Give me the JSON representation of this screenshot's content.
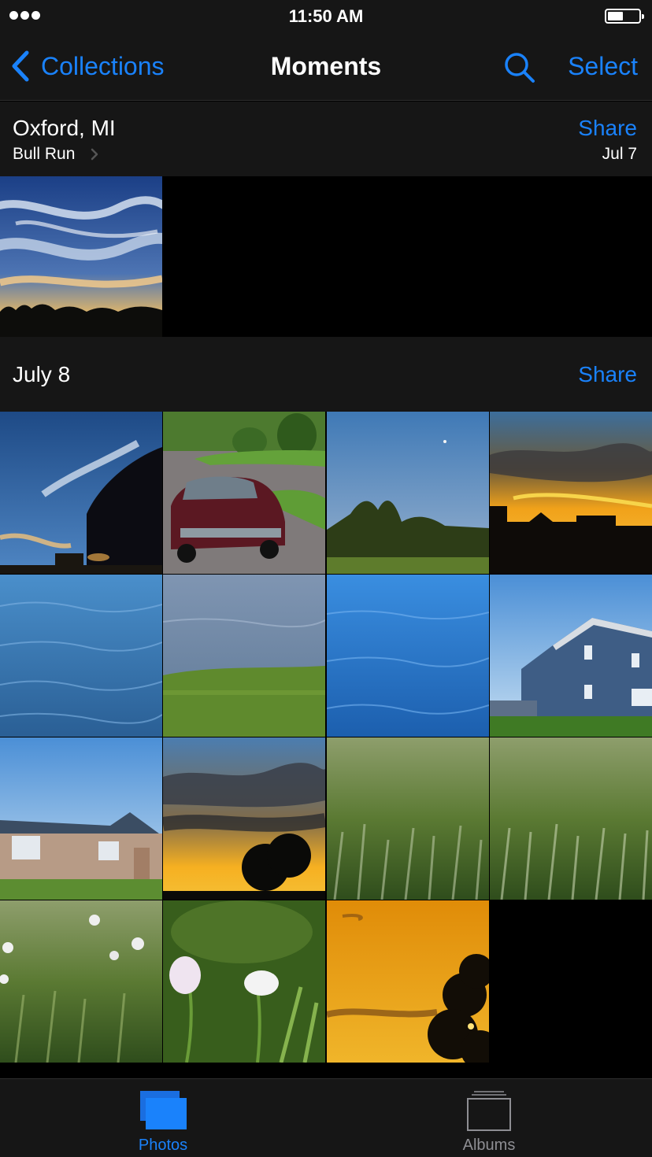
{
  "status_bar": {
    "time": "11:50 AM"
  },
  "nav": {
    "back_label": "Collections",
    "title": "Moments",
    "select_label": "Select"
  },
  "moments": [
    {
      "title": "Oxford, MI",
      "subtitle": "Bull Run",
      "date": "Jul 7",
      "share_label": "Share",
      "photos": [
        "sky-clouds-sunset"
      ]
    },
    {
      "title": "July 8",
      "share_label": "Share",
      "photos": [
        "van-sky-clouds",
        "maroon-car-driveway",
        "trees-blue-sky",
        "sunset-houses-silhouette",
        "water-ripples",
        "water-and-grass",
        "blue-water",
        "blue-house",
        "brick-ranch-house",
        "sunset-clouds-tree",
        "grass-closeup",
        "grass-closeup-2",
        "clover-flowers-grass",
        "clover-flower-closeup",
        "orange-sunset-tree"
      ]
    }
  ],
  "tab_bar": {
    "photos_label": "Photos",
    "albums_label": "Albums"
  },
  "colors": {
    "accent": "#1a82fb",
    "bar_background": "#161616",
    "inactive_tab": "#8e8e93"
  }
}
